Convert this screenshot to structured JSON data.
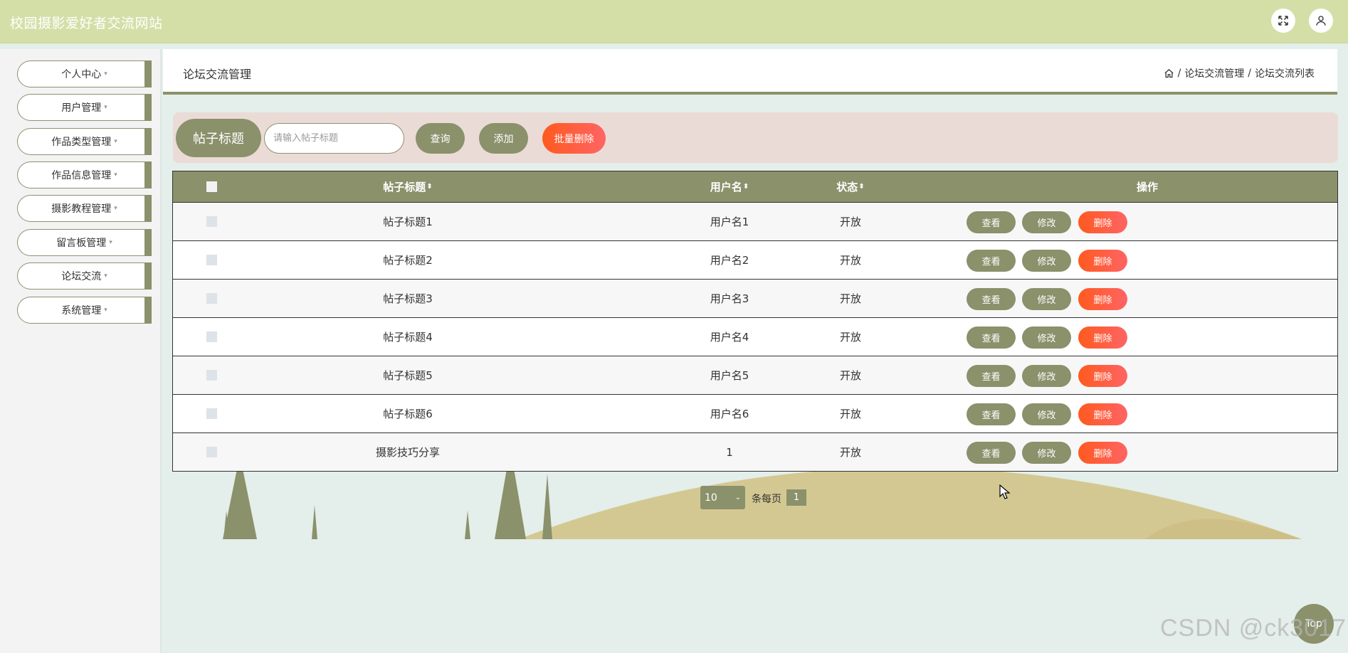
{
  "app": {
    "title": "校园摄影爱好者交流网站"
  },
  "header_icons": [
    "fullscreen-icon",
    "user-icon"
  ],
  "sidebar": {
    "items": [
      {
        "label": "个人中心"
      },
      {
        "label": "用户管理"
      },
      {
        "label": "作品类型管理"
      },
      {
        "label": "作品信息管理"
      },
      {
        "label": "摄影教程管理"
      },
      {
        "label": "留言板管理"
      },
      {
        "label": "论坛交流"
      },
      {
        "label": "系统管理"
      }
    ],
    "caret": "▾"
  },
  "content_header": {
    "title": "论坛交流管理",
    "breadcrumb": {
      "sep": "/",
      "level1": "论坛交流管理",
      "level2": "论坛交流列表"
    }
  },
  "search": {
    "label": "帖子标题",
    "placeholder": "请输入帖子标题",
    "query_button": "查询",
    "add_button": "添加",
    "batch_delete_button": "批量删除"
  },
  "table": {
    "columns": {
      "title": "帖子标题",
      "username": "用户名",
      "status": "状态",
      "actions": "操作"
    },
    "sort_icon": "⬍",
    "action_labels": {
      "view": "查看",
      "edit": "修改",
      "delete": "删除"
    },
    "rows": [
      {
        "title": "帖子标题1",
        "username": "用户名1",
        "status": "开放"
      },
      {
        "title": "帖子标题2",
        "username": "用户名2",
        "status": "开放"
      },
      {
        "title": "帖子标题3",
        "username": "用户名3",
        "status": "开放"
      },
      {
        "title": "帖子标题4",
        "username": "用户名4",
        "status": "开放"
      },
      {
        "title": "帖子标题5",
        "username": "用户名5",
        "status": "开放"
      },
      {
        "title": "帖子标题6",
        "username": "用户名6",
        "status": "开放"
      },
      {
        "title": "摄影技巧分享",
        "username": "1",
        "status": "开放"
      }
    ]
  },
  "pagination": {
    "page_size": "10",
    "per_page_label": "条每页",
    "current_page": "1"
  },
  "back_to_top": "Top",
  "watermark": "CSDN @ck3017",
  "colors": {
    "olive": "#8a916b",
    "topbar": "#d3dfa7",
    "danger": "#ff5a1f"
  }
}
